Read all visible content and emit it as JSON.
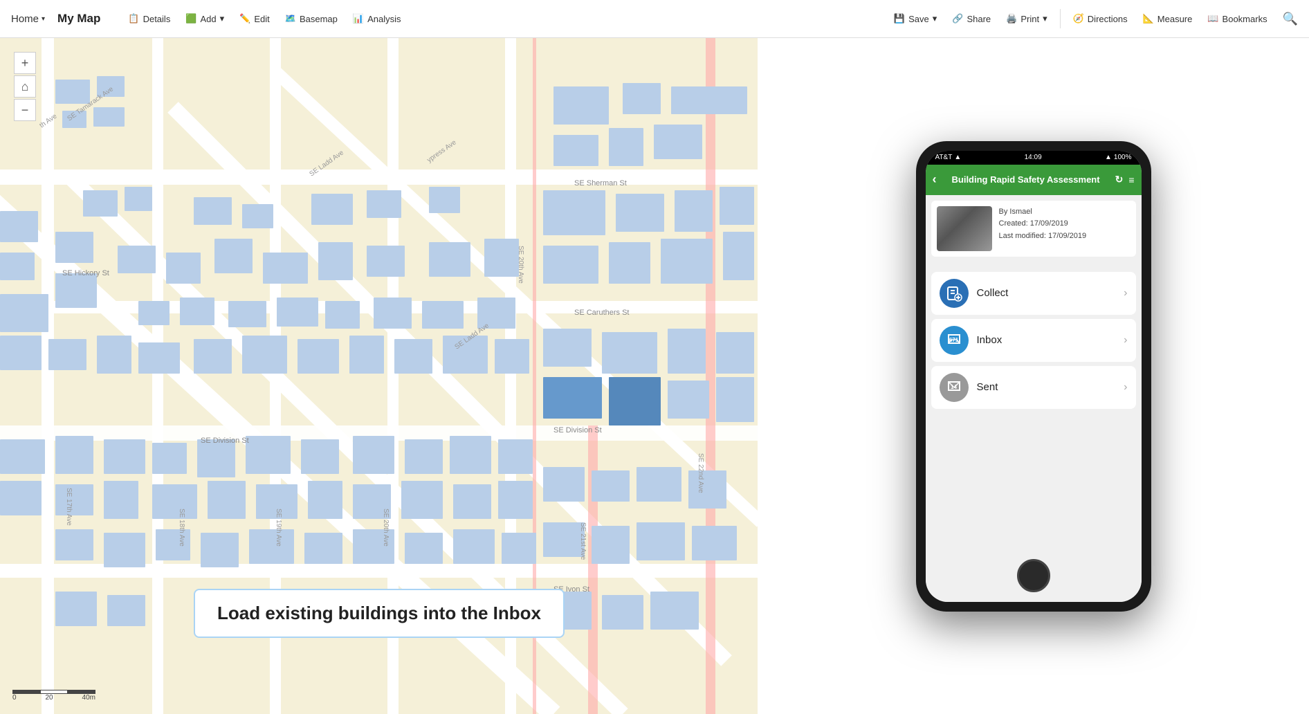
{
  "topbar": {
    "home_label": "Home",
    "map_title": "My Map",
    "btn_details": "Details",
    "btn_add": "Add",
    "btn_edit": "Edit",
    "btn_basemap": "Basemap",
    "btn_analysis": "Analysis",
    "btn_save": "Save",
    "btn_share": "Share",
    "btn_print": "Print",
    "btn_directions": "Directions",
    "btn_measure": "Measure",
    "btn_bookmarks": "Bookmarks"
  },
  "map": {
    "tooltip": "Load existing buildings into the Inbox",
    "scale_labels": [
      "0",
      "20",
      "40m"
    ]
  },
  "phone": {
    "status_left": "AT&T",
    "status_time": "14:09",
    "status_battery": "100%",
    "header_title": "Building Rapid Safety Assessment",
    "card_author": "By Ismael",
    "card_created": "Created: 17/09/2019",
    "card_modified": "Last modified: 17/09/2019",
    "menu_collect": "Collect",
    "menu_inbox": "Inbox",
    "menu_sent": "Sent",
    "inbox_badge": "671",
    "sent_badge": "14"
  }
}
